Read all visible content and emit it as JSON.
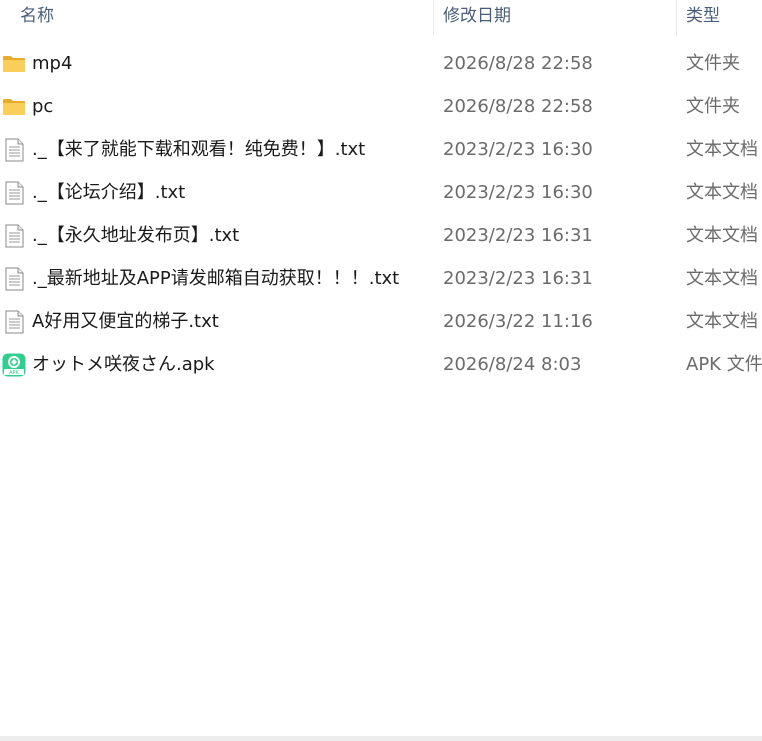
{
  "columns": {
    "name": "名称",
    "date": "修改日期",
    "type": "类型"
  },
  "sort_indicator": "^",
  "files": [
    {
      "name": "mp4",
      "date": "2026/8/28 22:58",
      "type": "文件夹",
      "icon": "folder-icon"
    },
    {
      "name": "pc",
      "date": "2026/8/28 22:58",
      "type": "文件夹",
      "icon": "folder-icon"
    },
    {
      "name": "._【来了就能下载和观看！纯免费！】.txt",
      "date": "2023/2/23 16:30",
      "type": "文本文档",
      "icon": "text-file-icon"
    },
    {
      "name": "._【论坛介绍】.txt",
      "date": "2023/2/23 16:30",
      "type": "文本文档",
      "icon": "text-file-icon"
    },
    {
      "name": "._【永久地址发布页】.txt",
      "date": "2023/2/23 16:31",
      "type": "文本文档",
      "icon": "text-file-icon"
    },
    {
      "name": "._最新地址及APP请发邮箱自动获取！！！.txt",
      "date": "2023/2/23 16:31",
      "type": "文本文档",
      "icon": "text-file-icon"
    },
    {
      "name": "A好用又便宜的梯子.txt",
      "date": "2026/3/22 11:16",
      "type": "文本文档",
      "icon": "text-file-icon"
    },
    {
      "name": "オットメ咲夜さん.apk",
      "date": "2026/8/24 8:03",
      "type": "APK 文件",
      "icon": "apk-file-icon",
      "icon_label": "APK"
    }
  ],
  "colors": {
    "header_text": "#4b5d7a",
    "folder": "#f7c64a",
    "apk": "#2fd08f"
  }
}
